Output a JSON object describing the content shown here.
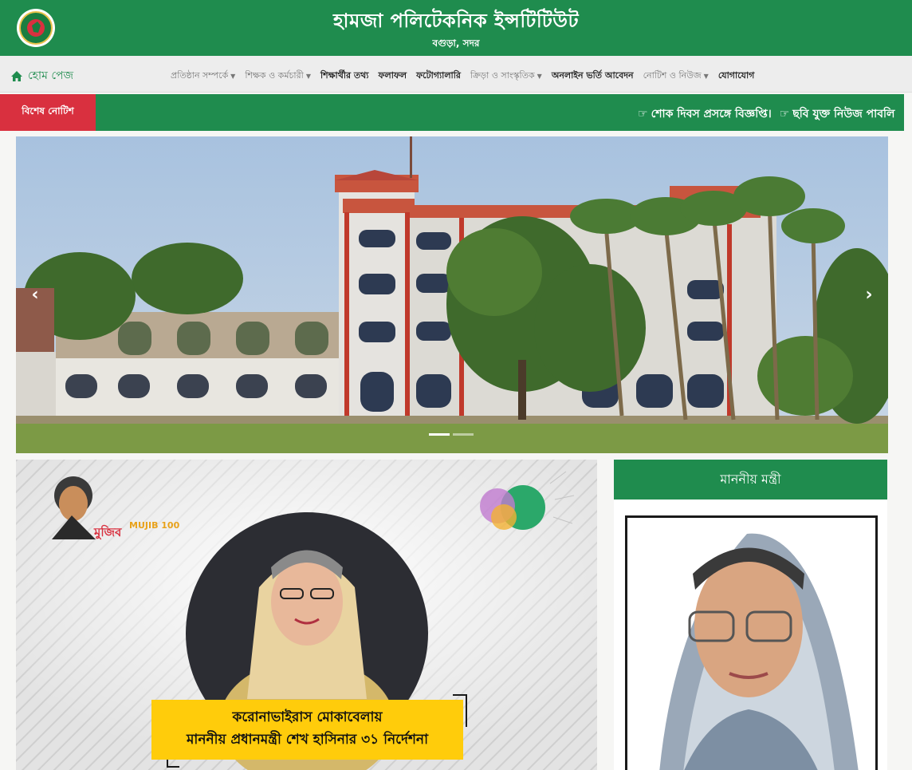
{
  "header": {
    "title": "হামজা পলিটেকনিক ইন্সটিটিউট",
    "subtitle": "বগুড়া, সদর",
    "logo_icon": "government-seal-icon"
  },
  "nav": {
    "home_label": "হোম পেজ",
    "items": [
      {
        "label": "প্রতিষ্ঠান সম্পর্কে",
        "dropdown": true
      },
      {
        "label": "শিক্ষক ও কর্মচারী",
        "dropdown": true
      },
      {
        "label": "শিক্ষার্থীর তথ্য",
        "dropdown": false
      },
      {
        "label": "ফলাফল",
        "dropdown": false
      },
      {
        "label": "ফটোগ্যালারি",
        "dropdown": false
      },
      {
        "label": "ক্রিড়া ও সাংস্কৃতিক",
        "dropdown": true
      },
      {
        "label": "অনলাইন ভর্তি আবেদন",
        "dropdown": false
      },
      {
        "label": "নোটিশ ও নিউজ",
        "dropdown": true
      },
      {
        "label": "যোগাযোগ",
        "dropdown": false
      }
    ]
  },
  "notice": {
    "label": "বিশেষ নোটিশ",
    "items": [
      "শোক দিবস প্রসঙ্গে বিজ্ঞপ্তি।",
      "ছবি যুক্ত নিউজ পাবলি"
    ],
    "bullet_icon": "pointing-hand-icon"
  },
  "slider": {
    "prev_glyph": "‹",
    "next_glyph": "›",
    "slide_count": 2,
    "active_slide": 1
  },
  "banner": {
    "caption_line1": "করোনাভাইরাস মোকাবেলায়",
    "caption_line2": "মাননীয় প্রধানমন্ত্রী শেখ হাসিনার ৩১ নির্দেশনা",
    "mujib_logo_text": "মুজিব",
    "mujib_sub": "MUJIB 100"
  },
  "minister": {
    "title": "মাননীয় মন্ত্রী"
  },
  "colors": {
    "brand_green": "#1f8c4e",
    "notice_red": "#d9303f",
    "caption_yellow": "#ffcc0b"
  }
}
